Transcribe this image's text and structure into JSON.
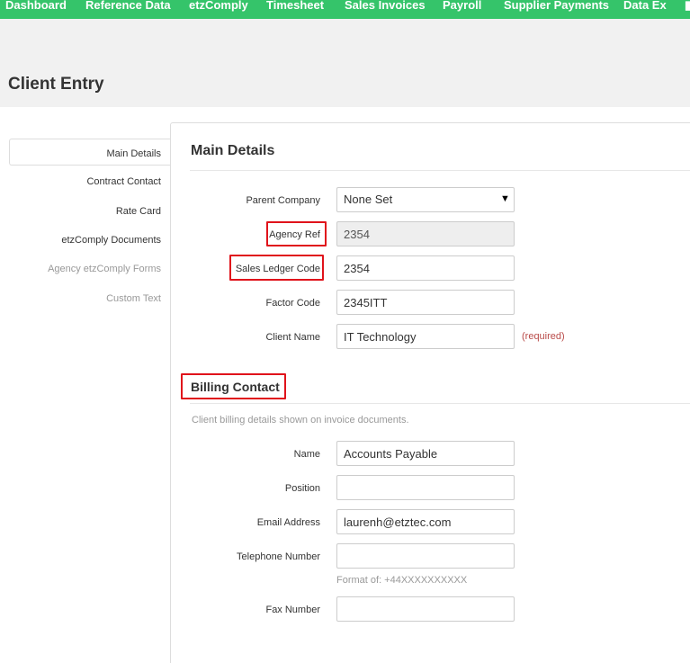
{
  "topnav": {
    "items": [
      "Dashboard",
      "Reference Data",
      "etzComply",
      "Timesheet",
      "Sales Invoices",
      "Payroll",
      "Supplier Payments",
      "Data Ex"
    ],
    "accent_color": "#35c46a"
  },
  "page": {
    "title": "Client Entry"
  },
  "sidebar": {
    "items": [
      {
        "label": "Main Details",
        "state": "active"
      },
      {
        "label": "Contract Contact",
        "state": "enabled"
      },
      {
        "label": "Rate Card",
        "state": "enabled"
      },
      {
        "label": "etzComply Documents",
        "state": "enabled"
      },
      {
        "label": "Agency etzComply Forms",
        "state": "disabled"
      },
      {
        "label": "Custom Text",
        "state": "disabled"
      }
    ]
  },
  "main_details": {
    "title": "Main Details",
    "parent_company": {
      "label": "Parent Company",
      "value": "None Set"
    },
    "agency_ref": {
      "label": "Agency Ref",
      "value": "2354"
    },
    "sales_ledger_code": {
      "label": "Sales Ledger Code",
      "value": "2354"
    },
    "factor_code": {
      "label": "Factor Code",
      "value": "2345ITT"
    },
    "client_name": {
      "label": "Client Name",
      "value": "IT Technology",
      "required_text": "(required)"
    }
  },
  "billing_contact": {
    "title": "Billing Contact",
    "description": "Client billing details shown on invoice documents.",
    "name": {
      "label": "Name",
      "value": "Accounts Payable"
    },
    "position": {
      "label": "Position",
      "value": ""
    },
    "email": {
      "label": "Email Address",
      "value": "laurenh@etztec.com"
    },
    "telephone": {
      "label": "Telephone Number",
      "value": "",
      "hint": "Format of: +44XXXXXXXXXX"
    },
    "fax": {
      "label": "Fax Number",
      "value": ""
    }
  },
  "highlight_color": "#e0131b"
}
